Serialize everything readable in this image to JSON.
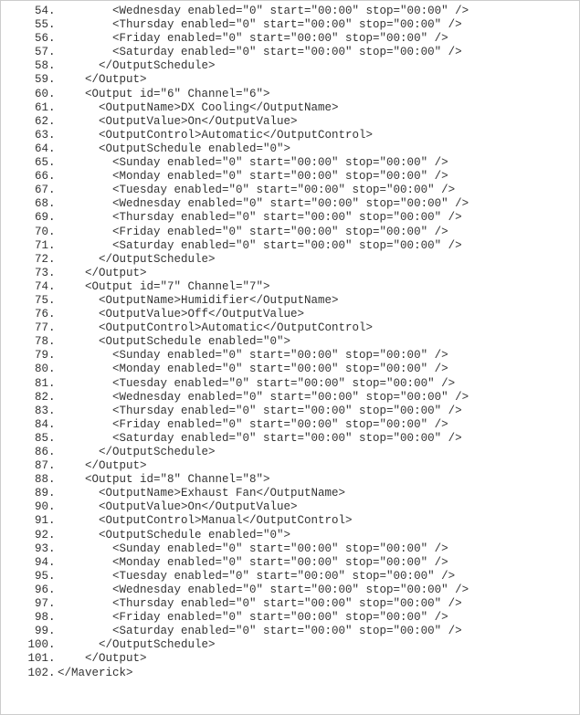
{
  "lines": [
    {
      "n": 54,
      "indent": 4,
      "text": "<Wednesday enabled=\"0\" start=\"00:00\" stop=\"00:00\" />"
    },
    {
      "n": 55,
      "indent": 4,
      "text": "<Thursday enabled=\"0\" start=\"00:00\" stop=\"00:00\" />"
    },
    {
      "n": 56,
      "indent": 4,
      "text": "<Friday enabled=\"0\" start=\"00:00\" stop=\"00:00\" />"
    },
    {
      "n": 57,
      "indent": 4,
      "text": "<Saturday enabled=\"0\" start=\"00:00\" stop=\"00:00\" />"
    },
    {
      "n": 58,
      "indent": 3,
      "text": "</OutputSchedule>"
    },
    {
      "n": 59,
      "indent": 2,
      "text": "</Output>"
    },
    {
      "n": 60,
      "indent": 2,
      "text": "<Output id=\"6\" Channel=\"6\">"
    },
    {
      "n": 61,
      "indent": 3,
      "text": "<OutputName>DX Cooling</OutputName>"
    },
    {
      "n": 62,
      "indent": 3,
      "text": "<OutputValue>On</OutputValue>"
    },
    {
      "n": 63,
      "indent": 3,
      "text": "<OutputControl>Automatic</OutputControl>"
    },
    {
      "n": 64,
      "indent": 3,
      "text": "<OutputSchedule enabled=\"0\">"
    },
    {
      "n": 65,
      "indent": 4,
      "text": "<Sunday enabled=\"0\" start=\"00:00\" stop=\"00:00\" />"
    },
    {
      "n": 66,
      "indent": 4,
      "text": "<Monday enabled=\"0\" start=\"00:00\" stop=\"00:00\" />"
    },
    {
      "n": 67,
      "indent": 4,
      "text": "<Tuesday enabled=\"0\" start=\"00:00\" stop=\"00:00\" />"
    },
    {
      "n": 68,
      "indent": 4,
      "text": "<Wednesday enabled=\"0\" start=\"00:00\" stop=\"00:00\" />"
    },
    {
      "n": 69,
      "indent": 4,
      "text": "<Thursday enabled=\"0\" start=\"00:00\" stop=\"00:00\" />"
    },
    {
      "n": 70,
      "indent": 4,
      "text": "<Friday enabled=\"0\" start=\"00:00\" stop=\"00:00\" />"
    },
    {
      "n": 71,
      "indent": 4,
      "text": "<Saturday enabled=\"0\" start=\"00:00\" stop=\"00:00\" />"
    },
    {
      "n": 72,
      "indent": 3,
      "text": "</OutputSchedule>"
    },
    {
      "n": 73,
      "indent": 2,
      "text": "</Output>"
    },
    {
      "n": 74,
      "indent": 2,
      "text": "<Output id=\"7\" Channel=\"7\">"
    },
    {
      "n": 75,
      "indent": 3,
      "text": "<OutputName>Humidifier</OutputName>"
    },
    {
      "n": 76,
      "indent": 3,
      "text": "<OutputValue>Off</OutputValue>"
    },
    {
      "n": 77,
      "indent": 3,
      "text": "<OutputControl>Automatic</OutputControl>"
    },
    {
      "n": 78,
      "indent": 3,
      "text": "<OutputSchedule enabled=\"0\">"
    },
    {
      "n": 79,
      "indent": 4,
      "text": "<Sunday enabled=\"0\" start=\"00:00\" stop=\"00:00\" />"
    },
    {
      "n": 80,
      "indent": 4,
      "text": "<Monday enabled=\"0\" start=\"00:00\" stop=\"00:00\" />"
    },
    {
      "n": 81,
      "indent": 4,
      "text": "<Tuesday enabled=\"0\" start=\"00:00\" stop=\"00:00\" />"
    },
    {
      "n": 82,
      "indent": 4,
      "text": "<Wednesday enabled=\"0\" start=\"00:00\" stop=\"00:00\" />"
    },
    {
      "n": 83,
      "indent": 4,
      "text": "<Thursday enabled=\"0\" start=\"00:00\" stop=\"00:00\" />"
    },
    {
      "n": 84,
      "indent": 4,
      "text": "<Friday enabled=\"0\" start=\"00:00\" stop=\"00:00\" />"
    },
    {
      "n": 85,
      "indent": 4,
      "text": "<Saturday enabled=\"0\" start=\"00:00\" stop=\"00:00\" />"
    },
    {
      "n": 86,
      "indent": 3,
      "text": "</OutputSchedule>"
    },
    {
      "n": 87,
      "indent": 2,
      "text": "</Output>"
    },
    {
      "n": 88,
      "indent": 2,
      "text": "<Output id=\"8\" Channel=\"8\">"
    },
    {
      "n": 89,
      "indent": 3,
      "text": "<OutputName>Exhaust Fan</OutputName>"
    },
    {
      "n": 90,
      "indent": 3,
      "text": "<OutputValue>On</OutputValue>"
    },
    {
      "n": 91,
      "indent": 3,
      "text": "<OutputControl>Manual</OutputControl>"
    },
    {
      "n": 92,
      "indent": 3,
      "text": "<OutputSchedule enabled=\"0\">"
    },
    {
      "n": 93,
      "indent": 4,
      "text": "<Sunday enabled=\"0\" start=\"00:00\" stop=\"00:00\" />"
    },
    {
      "n": 94,
      "indent": 4,
      "text": "<Monday enabled=\"0\" start=\"00:00\" stop=\"00:00\" />"
    },
    {
      "n": 95,
      "indent": 4,
      "text": "<Tuesday enabled=\"0\" start=\"00:00\" stop=\"00:00\" />"
    },
    {
      "n": 96,
      "indent": 4,
      "text": "<Wednesday enabled=\"0\" start=\"00:00\" stop=\"00:00\" />"
    },
    {
      "n": 97,
      "indent": 4,
      "text": "<Thursday enabled=\"0\" start=\"00:00\" stop=\"00:00\" />"
    },
    {
      "n": 98,
      "indent": 4,
      "text": "<Friday enabled=\"0\" start=\"00:00\" stop=\"00:00\" />"
    },
    {
      "n": 99,
      "indent": 4,
      "text": "<Saturday enabled=\"0\" start=\"00:00\" stop=\"00:00\" />"
    },
    {
      "n": 100,
      "indent": 3,
      "text": "</OutputSchedule>"
    },
    {
      "n": 101,
      "indent": 2,
      "text": "</Output>"
    },
    {
      "n": 102,
      "indent": 0,
      "text": "</Maverick>"
    }
  ]
}
